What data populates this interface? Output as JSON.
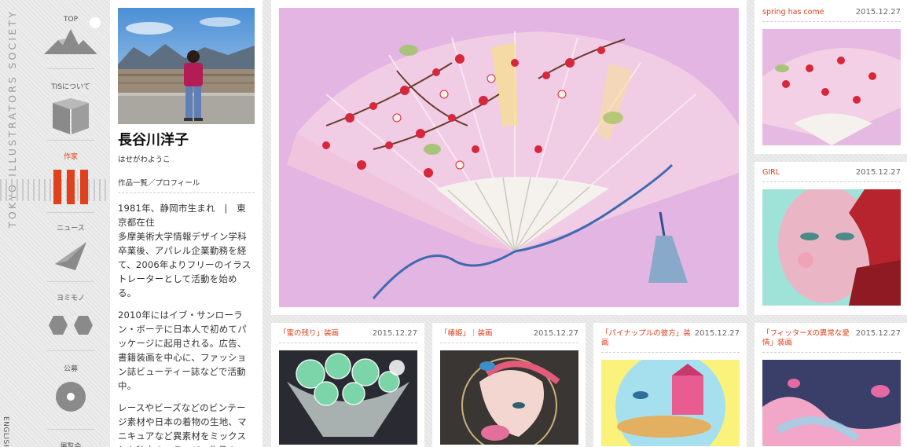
{
  "brand": {
    "vertical_text": "TOKYO ILLUSTRATORS SOCIETY",
    "english_link": "ENGLISH ◀"
  },
  "nav": {
    "items": [
      {
        "label": "TOP",
        "icon": "mountain-icon"
      },
      {
        "label": "TISについて",
        "icon": "open-book-icon"
      },
      {
        "label": "作家",
        "icon": "bars-icon",
        "active": true
      },
      {
        "label": "ニュース",
        "icon": "paper-plane-icon"
      },
      {
        "label": "ヨミモノ",
        "icon": "hexagons-icon"
      },
      {
        "label": "公募",
        "icon": "disc-icon"
      },
      {
        "label": "展覧会",
        "icon": "frame-icon"
      }
    ],
    "active_color": "#e0401c"
  },
  "profile": {
    "name": "長谷川洋子",
    "kana": "はせがわようこ",
    "link": "作品一覧／プロフィール",
    "bio": [
      "1981年、静岡市生まれ　|　東京都在住",
      "多摩美術大学情報デザイン学科卒業後、アパレル企業勤務を経て、2006年よりフリーのイラストレーターとして活動を始める。",
      "2010年にはイブ・サンローラン・ボーテに日本人で初めてパッケージに起用される。広告、書籍装画を中心に、ファッション誌ビューティー誌などで活動中。",
      "レースやビーズなどのビンテージ素材や日本の着物の生地、マニキュアなど異素材をミックスした独自のコラージュ作品の"
    ]
  },
  "works": [
    {
      "title": "spring has come",
      "date": "2015.12.27"
    },
    {
      "title": "GIRL",
      "date": "2015.12.27"
    },
    {
      "title": "「蜜の残り」装画",
      "date": "2015.12.27"
    },
    {
      "title": "「椿姫」｜装画",
      "date": "2015.12.27"
    },
    {
      "title": "「パイナップルの彼方」装画",
      "date": "2015.12.27"
    },
    {
      "title": "「フィッターXの異常な愛情」装画",
      "date": "2015.12.27"
    }
  ],
  "colors": {
    "accent": "#e0401c",
    "fan_background": "#e2b5e2"
  }
}
